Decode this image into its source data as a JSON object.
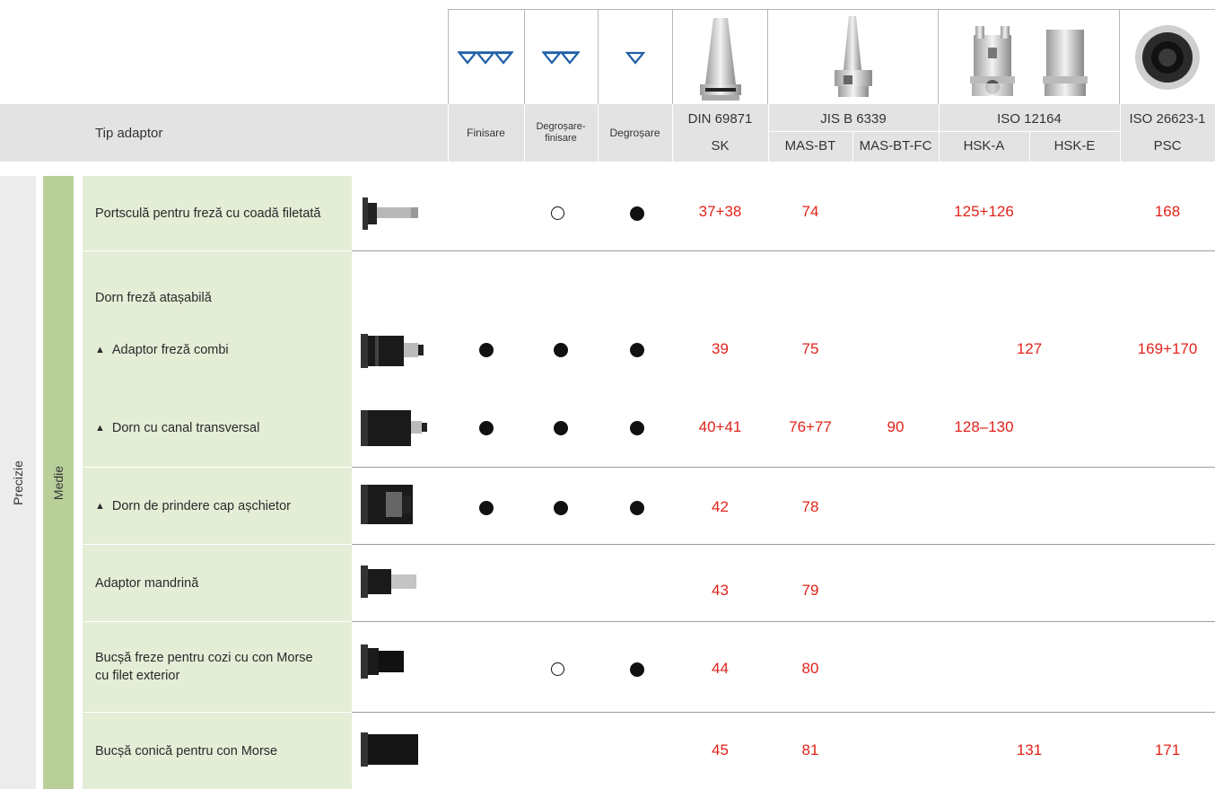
{
  "header": {
    "tip_adaptor": "Tip adaptor",
    "finisare": "Finisare",
    "degrosare_finisare_1": "Degroșare-",
    "degrosare_finisare_2": "finisare",
    "degrosare": "Degroșare",
    "din": "DIN 69871",
    "sk": "SK",
    "jis": "JIS B 6339",
    "masbt": "MAS-BT",
    "masbtfc": "MAS-BT-FC",
    "iso12164": "ISO 12164",
    "hska": "HSK-A",
    "hske": "HSK-E",
    "iso26623": "ISO 26623-1",
    "psc": "PSC"
  },
  "side": {
    "precizie": "Precizie",
    "medie": "Medie"
  },
  "rows": {
    "r1": {
      "label": "Portsculă pentru freză cu coadă filetată",
      "sk": "37+38",
      "masbt": "74",
      "hsk": "125+126",
      "psc": "168"
    },
    "r2head": {
      "label": "Dorn freză atașabilă"
    },
    "r2": {
      "label": "Adaptor freză combi",
      "sk": "39",
      "masbt": "75",
      "hsk": "127",
      "psc": "169+170"
    },
    "r3": {
      "label": "Dorn cu canal transversal",
      "sk": "40+41",
      "masbt": "76+77",
      "masbtfc": "90",
      "hsk": "128–130"
    },
    "r4": {
      "label": "Dorn de prindere cap așchietor",
      "sk": "42",
      "masbt": "78"
    },
    "r5": {
      "label": "Adaptor mandrină",
      "sk": "43",
      "masbt": "79"
    },
    "r6": {
      "label": "Bucșă freze pentru cozi cu con Morse cu filet exterior",
      "sk": "44",
      "masbt": "80"
    },
    "r7": {
      "label": "Bucșă conică pentru con Morse",
      "sk": "45",
      "masbt": "81",
      "hsk": "131",
      "psc": "171"
    }
  },
  "legend": {
    "triangle_marker": "▲",
    "filled": "filled-circle",
    "hollow": "hollow-circle"
  },
  "colors": {
    "value_red": "#e2231a",
    "label_bg": "#e4edd6",
    "medie_bg": "#b8cf9a",
    "header_bg": "#e3e3e3",
    "icon_blue": "#1f5fa8"
  }
}
